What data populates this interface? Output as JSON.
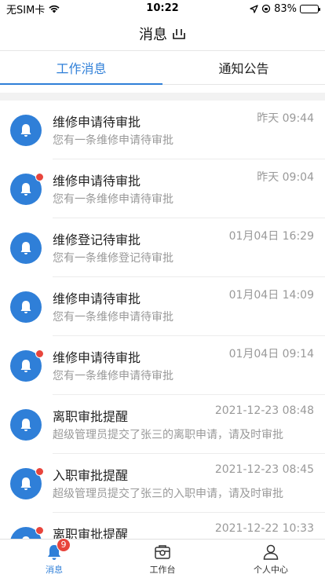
{
  "status_bar": {
    "carrier": "无SIM卡",
    "time": "10:22",
    "battery": "83%",
    "battery_level": 0.83
  },
  "header": {
    "title": "消息 "
  },
  "tabs": [
    {
      "label": "工作消息",
      "active": true
    },
    {
      "label": "通知公告",
      "active": false
    }
  ],
  "messages": [
    {
      "title": "维修申请待审批",
      "desc": "您有一条维修申请待审批",
      "time": "昨天 09:44",
      "unread": false
    },
    {
      "title": "维修申请待审批",
      "desc": "您有一条维修申请待审批",
      "time": "昨天 09:04",
      "unread": true
    },
    {
      "title": "维修登记待审批",
      "desc": "您有一条维修登记待审批",
      "time": "01月04日 16:29",
      "unread": false
    },
    {
      "title": "维修申请待审批",
      "desc": "您有一条维修申请待审批",
      "time": "01月04日 14:09",
      "unread": false
    },
    {
      "title": "维修申请待审批",
      "desc": "您有一条维修申请待审批",
      "time": "01月04日 09:14",
      "unread": true
    },
    {
      "title": "离职审批提醒",
      "desc": "超级管理员提交了张三的离职申请，请及时审批",
      "time": "2021-12-23 08:48",
      "unread": false
    },
    {
      "title": "入职审批提醒",
      "desc": "超级管理员提交了张三的入职申请，请及时审批",
      "time": "2021-12-23 08:45",
      "unread": true
    },
    {
      "title": "离职审批提醒",
      "desc": "",
      "time": "2021-12-22 10:33",
      "unread": true
    }
  ],
  "tabbar": {
    "items": [
      {
        "label": "消息",
        "icon": "bell-icon",
        "active": true,
        "badge": "9"
      },
      {
        "label": "工作台",
        "icon": "workbench-icon",
        "active": false
      },
      {
        "label": "个人中心",
        "icon": "person-icon",
        "active": false
      }
    ]
  },
  "colors": {
    "accent": "#2f7fd8",
    "badge": "#e8453c"
  }
}
